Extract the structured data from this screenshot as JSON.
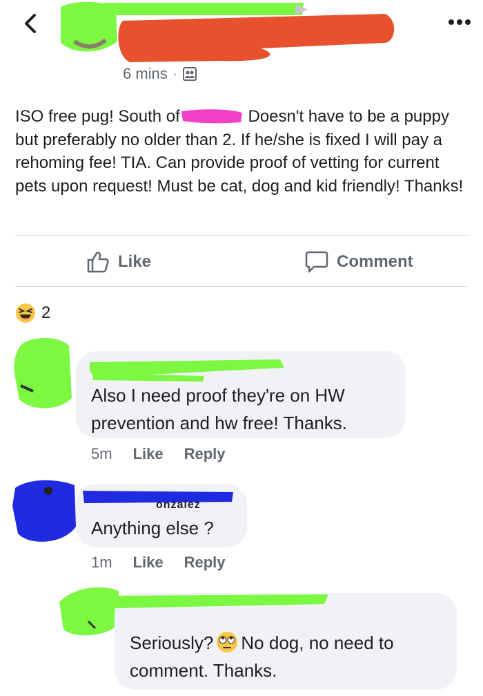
{
  "header": {
    "back_icon": "chevron-left-icon",
    "more_icon": "more-dots-icon"
  },
  "post": {
    "time": "6 mins",
    "separator": "·",
    "audience_icon": "group-audience-icon",
    "text_part1": "ISO free pug! South of",
    "text_part2": "Doesn't have to be a puppy but preferably no older than 2. If he/she is fixed I will pay a rehoming fee! TIA. Can provide proof of vetting for current pets upon request! Must be cat, dog and kid friendly! Thanks!"
  },
  "actions": {
    "like_label": "Like",
    "comment_label": "Comment"
  },
  "reactions": {
    "emoji": "laughing-emoji",
    "count": "2"
  },
  "comments": [
    {
      "text": "Also I need proof they're on HW prevention and hw free! Thanks.",
      "time": "5m",
      "like": "Like",
      "reply": "Reply"
    },
    {
      "name_fragment": "onzalez",
      "text": "Anything else ?",
      "time": "1m",
      "like": "Like",
      "reply": "Reply"
    },
    {
      "text_part1": "Seriously?",
      "emoji": "eye-roll-emoji",
      "text_part2": "No dog, no need to comment. Thanks."
    }
  ],
  "colors": {
    "redaction_green": "#7CF742",
    "redaction_red": "#E8512D",
    "redaction_magenta": "#F23FC7",
    "redaction_blue": "#1E2BE0",
    "meta_gray": "#606770",
    "bubble_bg": "#f0f2f5"
  }
}
